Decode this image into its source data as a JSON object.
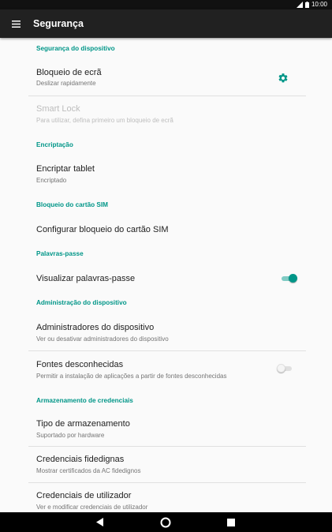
{
  "status_bar": {
    "time": "10:00"
  },
  "app_bar": {
    "title": "Segurança"
  },
  "sections": {
    "device_security": "Segurança do dispositivo",
    "encryption": "Encriptação",
    "sim_lock": "Bloqueio do cartão SIM",
    "passwords": "Palavras-passe",
    "device_admin": "Administração do dispositivo",
    "credential_storage": "Armazenamento de credenciais"
  },
  "items": {
    "screen_lock": {
      "title": "Bloqueio de ecrã",
      "subtitle": "Deslizar rapidamente"
    },
    "smart_lock": {
      "title": "Smart Lock",
      "subtitle": "Para utilizar, defina primeiro um bloqueio de ecrã"
    },
    "encrypt_tablet": {
      "title": "Encriptar tablet",
      "subtitle": "Encriptado"
    },
    "sim_lock_config": {
      "title": "Configurar bloqueio do cartão SIM"
    },
    "show_passwords": {
      "title": "Visualizar palavras-passe",
      "enabled": true
    },
    "device_admins": {
      "title": "Administradores do dispositivo",
      "subtitle": "Ver ou desativar administradores do dispositivo"
    },
    "unknown_sources": {
      "title": "Fontes desconhecidas",
      "subtitle": "Permitir a instalação de aplicações a partir de fontes desconhecidas",
      "enabled": false
    },
    "storage_type": {
      "title": "Tipo de armazenamento",
      "subtitle": "Suportado por hardware"
    },
    "trusted_credentials": {
      "title": "Credenciais fidedignas",
      "subtitle": "Mostrar certificados da AC fidedignos"
    },
    "user_credentials": {
      "title": "Credenciais de utilizador",
      "subtitle": "Ver e modificar credenciais de utilizador"
    }
  },
  "colors": {
    "accent": "#009688",
    "app_bar": "#212121",
    "background": "#fafafa"
  }
}
